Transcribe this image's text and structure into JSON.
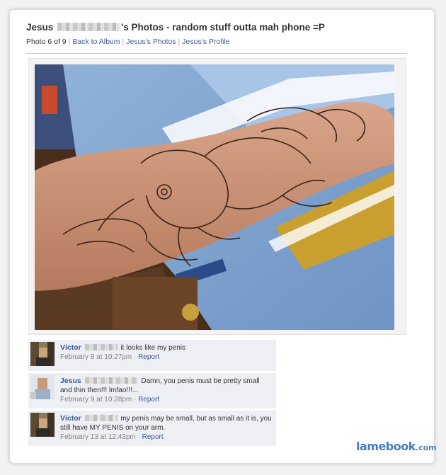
{
  "header": {
    "title_name": "Jesus",
    "title_rest": "'s Photos - random stuff outta mah phone =P",
    "photo_position": "Photo 6 of 9",
    "back_link": "Back to Album",
    "photos_link": "Jesus's Photos",
    "profile_link": "Jesus's Profile"
  },
  "comments": [
    {
      "author": "Víctor",
      "text": "it looks like my penis",
      "timestamp": "February 8 at 10:27pm",
      "report": "Report"
    },
    {
      "author": "Jesus",
      "text": "Damn, you penis must be pretty small and thin then!!! lmfao!!!...",
      "timestamp": "February 9 at 10:28pm",
      "report": "Report"
    },
    {
      "author": "Víctor",
      "text": "my penis may be small, but as small as it is, you still have MY PENIS on your arm.",
      "timestamp": "February 13 at 12:43pm",
      "report": "Report"
    }
  ],
  "brand": {
    "name": "lamebook",
    "suffix": ".com"
  },
  "colors": {
    "link": "#3b5998",
    "comment_bg": "#edeff4",
    "brand": "#4a7dbd"
  }
}
